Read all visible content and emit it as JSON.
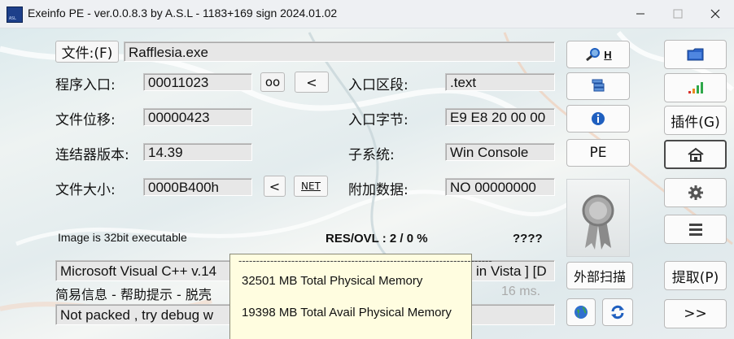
{
  "window": {
    "title": "Exeinfo PE - ver.0.0.8.3  by A.S.L -  1183+169 sign  2024.01.02",
    "app_icon_text": "ASL"
  },
  "file": {
    "button_label": "文件:(F)",
    "name": "Rafflesia.exe"
  },
  "fields": {
    "entry_point_label": "程序入口:",
    "entry_point": "00011023",
    "oo_button": "oo",
    "lt_button": "<",
    "entry_section_label": "入口区段:",
    "entry_section": ".text",
    "file_offset_label": "文件位移:",
    "file_offset": "00000423",
    "entry_bytes_label": "入口字节:",
    "entry_bytes": "E9 E8 20 00 00",
    "linker_label": "连结器版本:",
    "linker": "14.39",
    "subsystem_label": "子系统:",
    "subsystem": "Win Console",
    "file_size_label": "文件大小:",
    "file_size": "0000B400h",
    "size_lt_button": "<",
    "net_button": "NET",
    "overlay_label": "附加数据:",
    "overlay": "NO   00000000"
  },
  "status": {
    "image_info": "Image is 32bit executable",
    "res_ovl": "RES/OVL : 2 / 0 %",
    "unknown": "????",
    "compiler_line": "Microsoft Visual C++ v.14",
    "compiler_line_tail": "in Vista ] [D",
    "hint_line": "简易信息 - 帮助提示 - 脱壳",
    "timing": "16 ms.",
    "packed_line": "Not packed , try debug w"
  },
  "tooltip": {
    "dashes": "------------------------------------------------------------------------",
    "line1": "32501 MB Total Physical Memory",
    "line2": "19398 MB Total Avail Physical Memory"
  },
  "mid_buttons": {
    "h_label": "H",
    "pe_label": "PE",
    "scan_label": "外部扫描"
  },
  "right_buttons": {
    "plugins_label": "插件(G)",
    "extract_label": "提取(P)",
    "next_label": ">>"
  },
  "colors": {
    "accent_blue": "#1f5fbf",
    "chart_green": "#2fa84a",
    "chart_red": "#d9302c",
    "tooltip_bg": "#fffde0"
  },
  "icons": [
    "magnifier-icon",
    "stack-icon",
    "info-icon",
    "globe-icon",
    "refresh-icon",
    "folder-icon",
    "bars-icon",
    "home-icon",
    "gear-icon",
    "menu-icon",
    "award-icon"
  ]
}
